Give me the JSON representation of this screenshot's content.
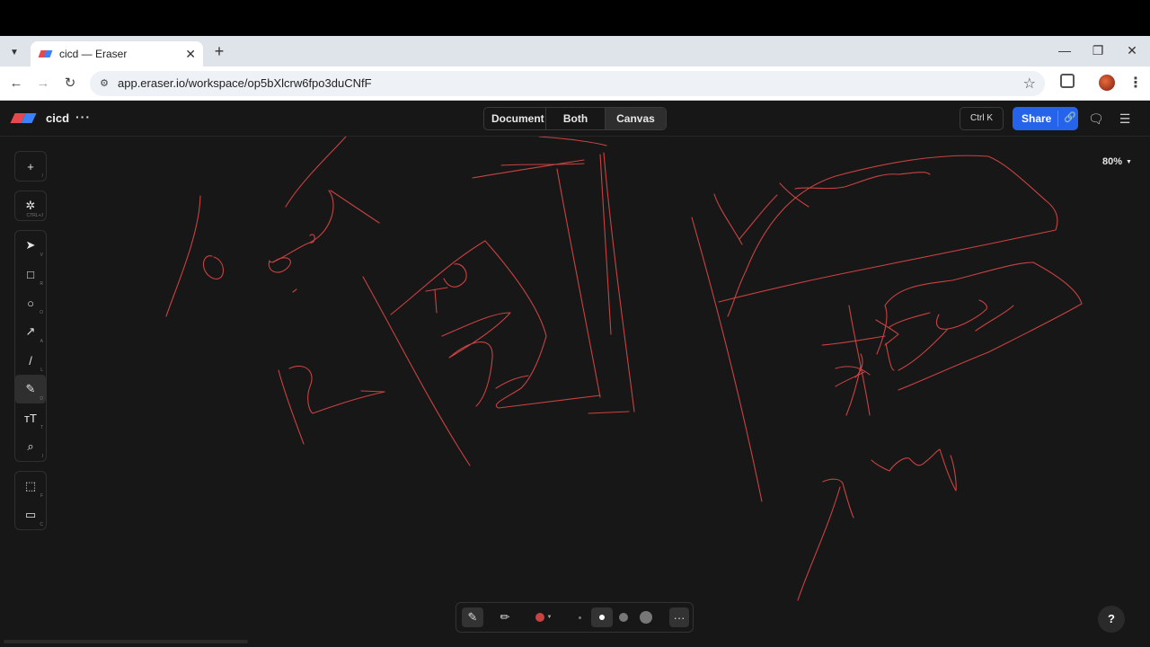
{
  "browser": {
    "tab_title": "cicd — Eraser",
    "url": "app.eraser.io/workspace/op5bXlcrw6fpo3duCNfF"
  },
  "app": {
    "doc_title": "cicd",
    "views": [
      "Document",
      "Both",
      "Canvas"
    ],
    "active_view": "Canvas",
    "command_shortcut": "Ctrl K",
    "share_label": "Share",
    "zoom_level": "80%",
    "help_label": "?"
  },
  "toolbar": {
    "tools": [
      {
        "name": "add",
        "icon": "+",
        "key": "/"
      },
      {
        "name": "ai-diagram",
        "icon": "✲",
        "key": "CTRL+J"
      },
      {
        "name": "select",
        "icon": "➤",
        "key": "V"
      },
      {
        "name": "rectangle",
        "icon": "□",
        "key": "R"
      },
      {
        "name": "ellipse",
        "icon": "○",
        "key": "O"
      },
      {
        "name": "arrow",
        "icon": "↗",
        "key": "A"
      },
      {
        "name": "line",
        "icon": "/",
        "key": "L"
      },
      {
        "name": "pencil",
        "icon": "✎",
        "key": "D"
      },
      {
        "name": "text",
        "icon": "ᴛT",
        "key": "T"
      },
      {
        "name": "icon-search",
        "icon": "⌕",
        "key": "I"
      },
      {
        "name": "frame",
        "icon": "⬚",
        "key": "F"
      },
      {
        "name": "comment",
        "icon": "▭",
        "key": "C"
      }
    ]
  },
  "pen_colors": {
    "stroke": "#c94242"
  }
}
